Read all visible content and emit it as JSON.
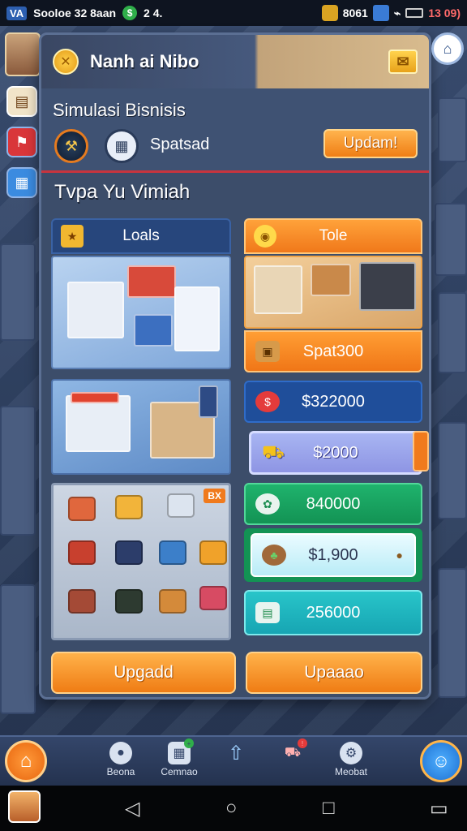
{
  "status_bar": {
    "left_chip": "VA",
    "left_text": "Sooloe 32 8aan",
    "counter": "2 4.",
    "right_text": "8061",
    "right_alert": "13 09)"
  },
  "header": {
    "title": "Nanh ai Nibo"
  },
  "business": {
    "title": "Simulasi Bisnisis",
    "sub_label": "Spatsad",
    "update_label": "Updam!"
  },
  "section_title": "Tvpa Yu Vimiah",
  "left_cards": {
    "loals_label": "Loals",
    "badge": "BX"
  },
  "right_cards": {
    "tole_label": "Tole",
    "rows": [
      {
        "value": "Spat300"
      },
      {
        "value": "$322000"
      },
      {
        "value": "$2000"
      },
      {
        "value": "840000"
      },
      {
        "value": "$1,900"
      },
      {
        "value": "256000"
      }
    ]
  },
  "buttons": {
    "left": "Upgadd",
    "right": "Upaaao"
  },
  "bottom_nav": {
    "items": [
      {
        "label": "Beona"
      },
      {
        "label": "Cemnao"
      },
      {
        "label": ""
      },
      {
        "label": ""
      },
      {
        "label": "Meobat"
      }
    ]
  },
  "colors": {
    "accent_orange": "#f07a1d",
    "panel_blue": "#3c4d6a",
    "alert_red": "#c8343e"
  }
}
